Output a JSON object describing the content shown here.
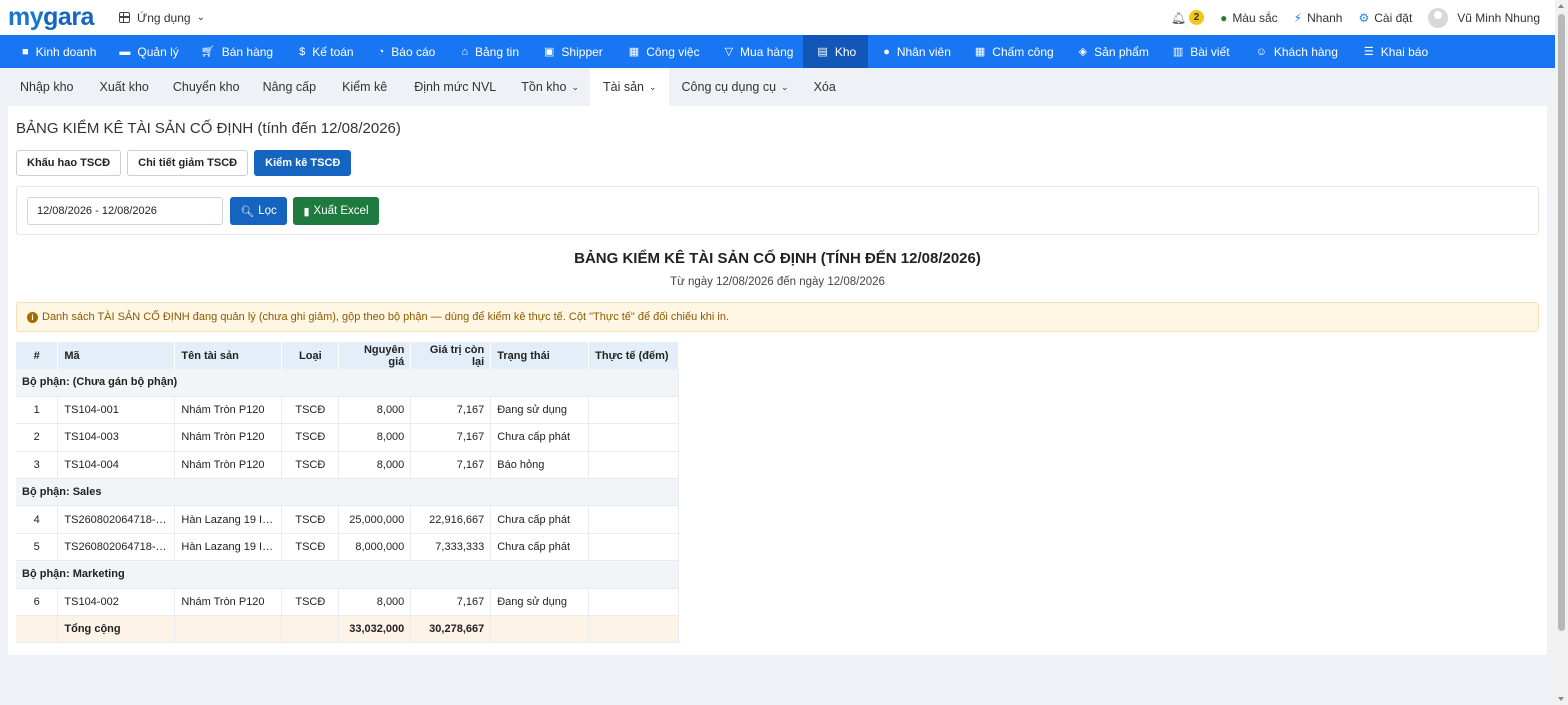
{
  "brand": {
    "logo_my": "my",
    "logo_gara": "gara"
  },
  "topbar": {
    "apps_label": "Ứng dụng",
    "notif_count": "2",
    "theme_label": "Màu sắc",
    "quick_label": "Nhanh",
    "settings_label": "Cài đặt",
    "user_name": "Vũ Minh Nhung"
  },
  "main_nav": [
    {
      "label": "Kinh doanh",
      "icon": "bag-icon"
    },
    {
      "label": "Quản lý",
      "icon": "id-card-icon"
    },
    {
      "label": "Bán hàng",
      "icon": "cart-icon"
    },
    {
      "label": "Kế toán",
      "icon": "dollar-icon"
    },
    {
      "label": "Báo cáo",
      "icon": "pie-chart-icon"
    },
    {
      "label": "Bảng tin",
      "icon": "home-icon"
    },
    {
      "label": "Shipper",
      "icon": "truck-icon"
    },
    {
      "label": "Công việc",
      "icon": "calendar-icon"
    },
    {
      "label": "Mua hàng",
      "icon": "basket-icon"
    },
    {
      "label": "Kho",
      "icon": "warehouse-icon"
    },
    {
      "label": "Nhân viên",
      "icon": "user-icon"
    },
    {
      "label": "Chấm công",
      "icon": "calendar-check-icon"
    },
    {
      "label": "Sản phẩm",
      "icon": "box-icon"
    },
    {
      "label": "Bài viết",
      "icon": "newspaper-icon"
    },
    {
      "label": "Khách hàng",
      "icon": "smile-icon"
    },
    {
      "label": "Khai báo",
      "icon": "list-icon"
    }
  ],
  "sub_nav": [
    {
      "label": "Nhập kho"
    },
    {
      "label": "Xuất kho"
    },
    {
      "label": "Chuyển kho"
    },
    {
      "label": "Nâng cấp"
    },
    {
      "label": "Kiểm kê"
    },
    {
      "label": "Định mức NVL"
    },
    {
      "label": "Tồn kho"
    },
    {
      "label": "Tài sản"
    },
    {
      "label": "Công cụ dụng cụ"
    },
    {
      "label": "Xóa"
    }
  ],
  "page": {
    "title": "BẢNG KIỂM KÊ TÀI SẢN CỐ ĐỊNH (tính đến 12/08/2026)",
    "tab_depreciation": "Khấu hao TSCĐ",
    "tab_reduction": "Chi tiết giảm TSCĐ",
    "tab_inventory": "Kiểm kê TSCĐ",
    "date_range": "12/08/2026 - 12/08/2026",
    "filter_label": "Lọc",
    "export_label": "Xuất Excel",
    "report_title": "BẢNG KIỂM KÊ TÀI SẢN CỐ ĐỊNH (TÍNH ĐẾN 12/08/2026)",
    "report_subtitle": "Từ ngày 12/08/2026 đến ngày 12/08/2026",
    "note": "Danh sách TÀI SẢN CỐ ĐỊNH đang quản lý (chưa ghi giảm), gộp theo bộ phận — dùng để kiểm kê thực tế. Cột \"Thực tế\" để đối chiếu khi in."
  },
  "table": {
    "headers": {
      "idx": "#",
      "code": "Mã",
      "name": "Tên tài sản",
      "type": "Loại",
      "cost": "Nguyên giá",
      "remaining": "Giá trị còn lại",
      "status": "Trạng thái",
      "actual": "Thực tế (đếm)"
    },
    "groups": [
      {
        "label": "Bộ phận: (Chưa gán bộ phận)",
        "rows": [
          {
            "idx": "1",
            "code": "TS104-001",
            "name": "Nhám Tròn P120",
            "type": "TSCĐ",
            "cost": "8,000",
            "remaining": "7,167",
            "status": "Đang sử dụng",
            "actual": ""
          },
          {
            "idx": "2",
            "code": "TS104-003",
            "name": "Nhám Tròn P120",
            "type": "TSCĐ",
            "cost": "8,000",
            "remaining": "7,167",
            "status": "Chưa cấp phát",
            "actual": ""
          },
          {
            "idx": "3",
            "code": "TS104-004",
            "name": "Nhám Tròn P120",
            "type": "TSCĐ",
            "cost": "8,000",
            "remaining": "7,167",
            "status": "Báo hỏng",
            "actual": ""
          }
        ]
      },
      {
        "label": "Bộ phận: Sales",
        "rows": [
          {
            "idx": "4",
            "code": "TS260802064718-0...",
            "name": "Hàn Lazang 19 In...",
            "type": "TSCĐ",
            "cost": "25,000,000",
            "remaining": "22,916,667",
            "status": "Chưa cấp phát",
            "actual": ""
          },
          {
            "idx": "5",
            "code": "TS260802064718-0...",
            "name": "Hàn Lazang 19 In...",
            "type": "TSCĐ",
            "cost": "8,000,000",
            "remaining": "7,333,333",
            "status": "Chưa cấp phát",
            "actual": ""
          }
        ]
      },
      {
        "label": "Bộ phận: Marketing",
        "rows": [
          {
            "idx": "6",
            "code": "TS104-002",
            "name": "Nhám Tròn P120",
            "type": "TSCĐ",
            "cost": "8,000",
            "remaining": "7,167",
            "status": "Đang sử dụng",
            "actual": ""
          }
        ]
      }
    ],
    "total": {
      "label": "Tổng cộng",
      "cost": "33,032,000",
      "remaining": "30,278,667"
    }
  },
  "colors": {
    "nav_bg": "#1976f2",
    "nav_active": "#1257b8",
    "primary_button": "#1565c0",
    "excel_button": "#1e7a3e",
    "note_bg": "#fff6e3",
    "header_bg": "#e3eef9"
  }
}
